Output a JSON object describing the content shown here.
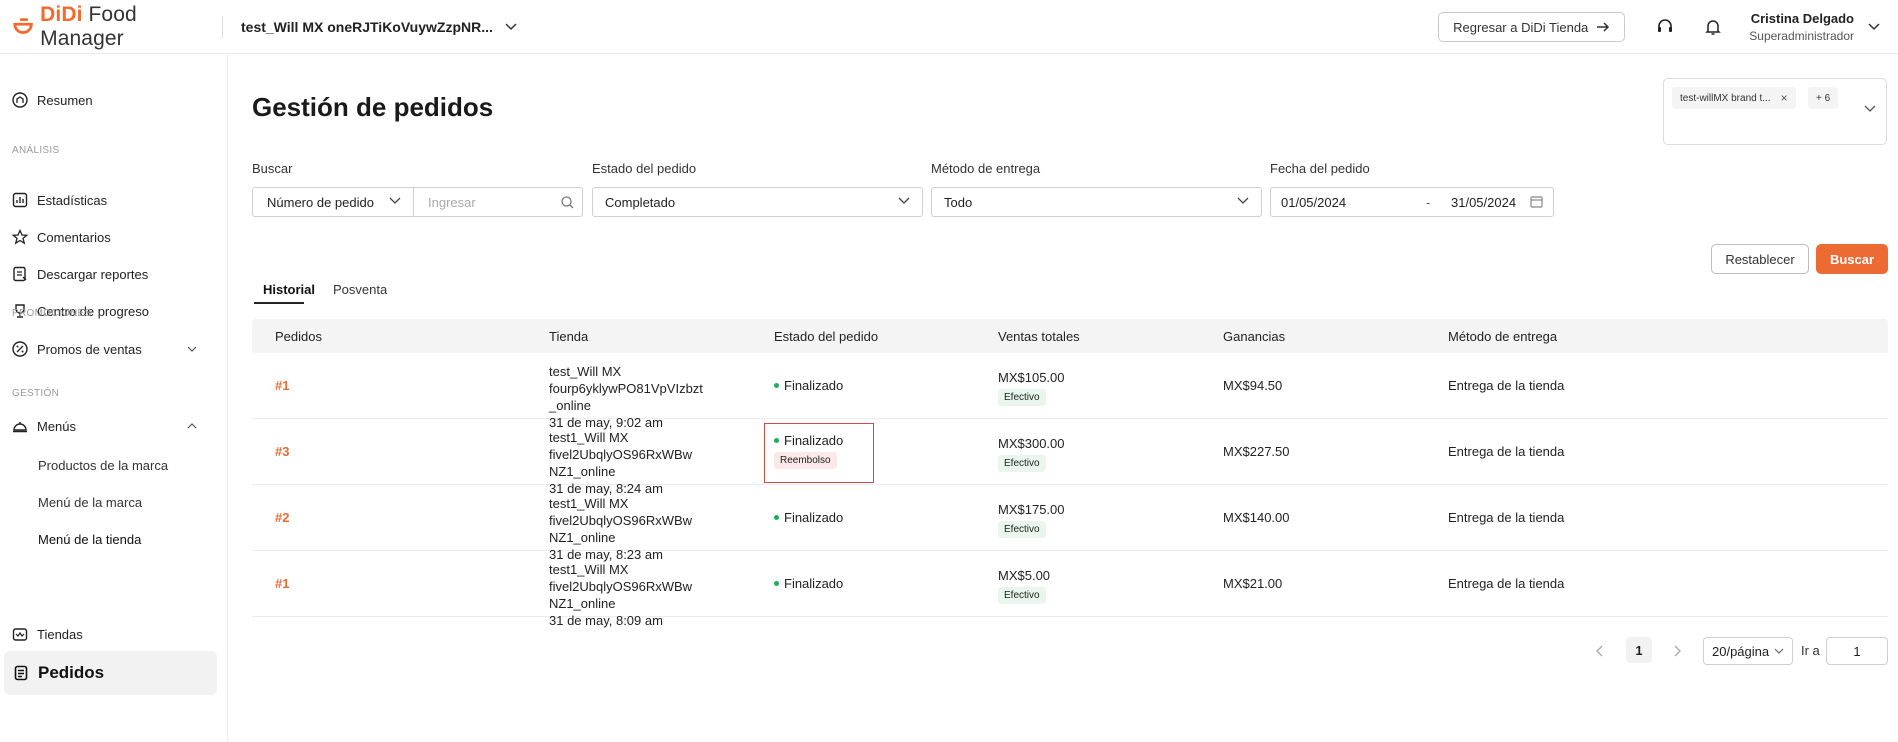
{
  "header": {
    "logo_prefix": "DiDi",
    "logo_suffix": " Food Manager",
    "store_selector": "test_Will MX oneRJTiKoVuywZzpNR...",
    "back_button": "Regresar a DiDi Tienda",
    "user_name": "Cristina Delgado",
    "user_role": "Superadministrador",
    "brand_color": "#f26a2d"
  },
  "sidebar": {
    "resumen": "Resumen",
    "section_analisis": "ANÁLISIS",
    "estadisticas": "Estadísticas",
    "comentarios": "Comentarios",
    "descargar": "Descargar reportes",
    "progreso": "Centro de progreso",
    "section_promociones": "PROMOCIONES",
    "promos": "Promos de ventas",
    "section_gestion": "GESTIÓN",
    "menus": "Menús",
    "productos_marca": "Productos de la marca",
    "menu_marca": "Menú de la marca",
    "menu_tienda": "Menú de la tienda",
    "pedidos": "Pedidos",
    "tiendas": "Tiendas"
  },
  "page": {
    "title": "Gestión de pedidos",
    "brand_tag": "test-willMX brand t...",
    "brand_more": "+ 6"
  },
  "filters": {
    "search_label": "Buscar",
    "search_type": "Número de pedido",
    "search_placeholder": "Ingresar",
    "status_label": "Estado del pedido",
    "status_value": "Completado",
    "delivery_label": "Método de entrega",
    "delivery_value": "Todo",
    "date_label": "Fecha del pedido",
    "date_from": "01/05/2024",
    "date_sep": "-",
    "date_to": "31/05/2024",
    "reset_button": "Restablecer",
    "search_button": "Buscar"
  },
  "tabs": [
    "Historial",
    "Posventa"
  ],
  "table": {
    "headers": [
      "Pedidos",
      "Tienda",
      "Estado del pedido",
      "Ventas totales",
      "Ganancias",
      "Método de entrega"
    ],
    "rows": [
      {
        "id": "#1",
        "store1": "test_Will MX fourp6yklywPO81VpVIzbzt",
        "store2": "_online",
        "date": "31 de may, 9:02 am",
        "status": "Finalizado",
        "badge": "",
        "sales": "MX$105.00",
        "payment": "Efectivo",
        "gain": "MX$94.50",
        "method": "Entrega de la tienda"
      },
      {
        "id": "#3",
        "store1": "test1_Will MX fivel2UbqlyOS96RxWBw",
        "store2": "NZ1_online",
        "date": "31 de may, 8:24 am",
        "status": "Finalizado",
        "badge": "Reembolso",
        "sales": "MX$300.00",
        "payment": "Efectivo",
        "gain": "MX$227.50",
        "method": "Entrega de la tienda"
      },
      {
        "id": "#2",
        "store1": "test1_Will MX fivel2UbqlyOS96RxWBw",
        "store2": "NZ1_online",
        "date": "31 de may, 8:23 am",
        "status": "Finalizado",
        "badge": "",
        "sales": "MX$175.00",
        "payment": "Efectivo",
        "gain": "MX$140.00",
        "method": "Entrega de la tienda"
      },
      {
        "id": "#1",
        "store1": "test1_Will MX fivel2UbqlyOS96RxWBw",
        "store2": "NZ1_online",
        "date": "31 de may, 8:09 am",
        "status": "Finalizado",
        "badge": "",
        "sales": "MX$5.00",
        "payment": "Efectivo",
        "gain": "MX$21.00",
        "method": "Entrega de la tienda"
      }
    ]
  },
  "pagination": {
    "current": "1",
    "page_size": "20/página",
    "go_label": "Ir a",
    "go_value": "1"
  }
}
